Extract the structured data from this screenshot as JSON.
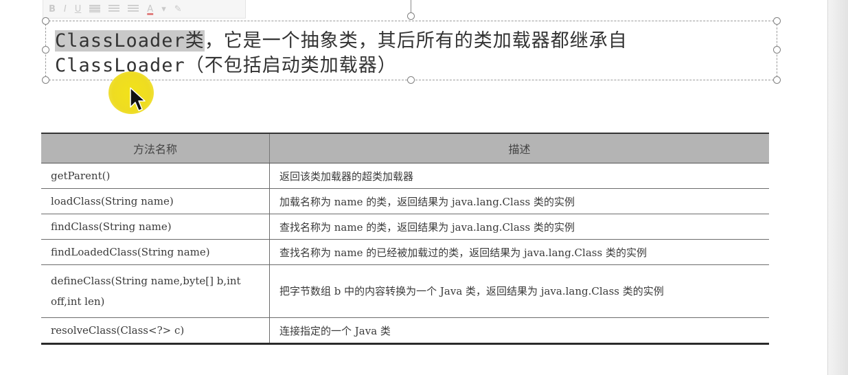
{
  "toolbar": {
    "bold_label": "B",
    "italic_label": "I",
    "underline_label": "U",
    "font_color_label": "A",
    "font_color_arrow": "▾",
    "format_painter_glyph": "✎"
  },
  "textbox": {
    "line1_highlight": "ClassLoader类",
    "line1_rest": "，它是一个抽象类，其后所有的类加载器都继承自",
    "line2_code": "ClassLoader",
    "line2_rest": "（不包括启动类加载器）"
  },
  "table": {
    "headers": [
      "方法名称",
      "描述"
    ],
    "rows": [
      {
        "method": "getParent()",
        "desc": "返回该类加载器的超类加载器"
      },
      {
        "method": "loadClass(String name)",
        "desc": "加载名称为 name 的类，返回结果为 java.lang.Class 类的实例"
      },
      {
        "method": "findClass(String name)",
        "desc": "查找名称为 name 的类，返回结果为 java.lang.Class 类的实例"
      },
      {
        "method": "findLoadedClass(String name)",
        "desc": "查找名称为 name 的已经被加载过的类，返回结果为 java.lang.Class 类的实例"
      },
      {
        "method": "defineClass(String name,byte[] b,int off,int len)",
        "desc": "把字节数组 b 中的内容转换为一个 Java 类，返回结果为 java.lang.Class 类的实例"
      },
      {
        "method": "resolveClass(Class<?> c)",
        "desc": "连接指定的一个 Java 类"
      }
    ]
  },
  "colors": {
    "cursor_highlight": "#eedc22",
    "table_header_bg": "#b4b4b4",
    "text_highlight": "#c9c9c9"
  }
}
